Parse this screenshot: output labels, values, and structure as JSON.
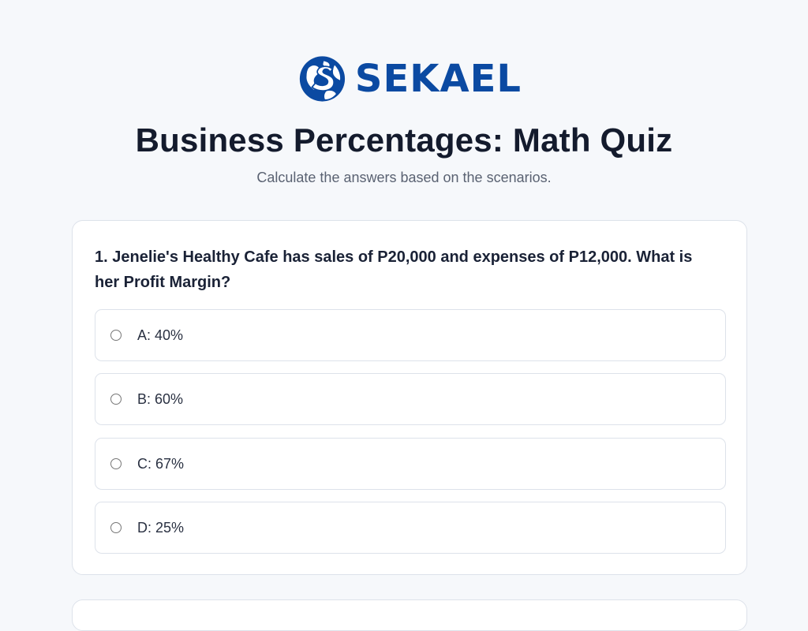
{
  "brand": {
    "name": "SEKAEL",
    "color": "#0b4aa2",
    "logo_icon": "globe-s-icon"
  },
  "quiz": {
    "title": "Business Percentages: Math Quiz",
    "subtitle": "Calculate the answers based on the scenarios."
  },
  "questions": [
    {
      "text": "1. Jenelie's Healthy Cafe has sales of P20,000 and expenses of P12,000. What is her Profit Margin?",
      "options": [
        {
          "label": "A: 40%",
          "selected": false
        },
        {
          "label": "B: 60%",
          "selected": false
        },
        {
          "label": "C: 67%",
          "selected": false
        },
        {
          "label": "D: 25%",
          "selected": false
        }
      ]
    }
  ]
}
